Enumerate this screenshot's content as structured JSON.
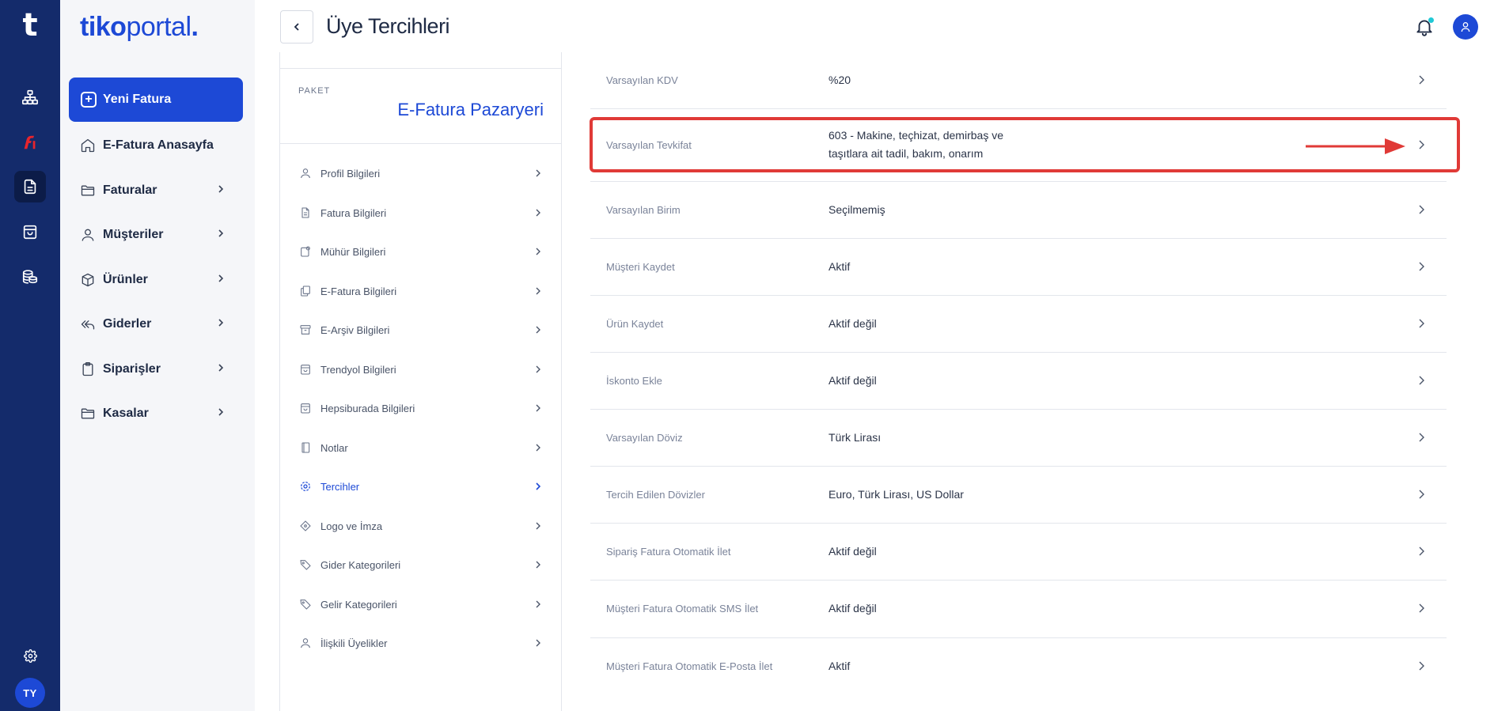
{
  "rail": {
    "logo": "t",
    "items": [
      {
        "icon": "org-chart-icon"
      },
      {
        "icon": "efatura-logo-icon"
      },
      {
        "icon": "document-icon",
        "active": true
      },
      {
        "icon": "shopping-bag-icon"
      },
      {
        "icon": "coins-icon"
      }
    ],
    "settings_icon": "gear-icon",
    "avatar_initials": "TY"
  },
  "brand": {
    "part1": "tiko",
    "part2": "portal",
    "part3": "."
  },
  "nav": {
    "new_invoice_label": "Yeni Fatura",
    "items": [
      {
        "label": "E-Fatura Anasayfa",
        "icon": "home-icon",
        "has_children": false
      },
      {
        "label": "Faturalar",
        "icon": "folder-icon",
        "has_children": true
      },
      {
        "label": "Müşteriler",
        "icon": "user-icon",
        "has_children": true
      },
      {
        "label": "Ürünler",
        "icon": "box-icon",
        "has_children": true
      },
      {
        "label": "Giderler",
        "icon": "reply-all-icon",
        "has_children": true
      },
      {
        "label": "Siparişler",
        "icon": "clipboard-icon",
        "has_children": true
      },
      {
        "label": "Kasalar",
        "icon": "folder-icon",
        "has_children": true
      }
    ]
  },
  "header": {
    "title": "Üye Tercihleri",
    "notification_icon": "bell-icon",
    "user_icon": "user-icon"
  },
  "package": {
    "label": "PAKET",
    "name": "E-Fatura Pazaryeri"
  },
  "menu": {
    "items": [
      {
        "label": "Profil Bilgileri",
        "icon": "user-icon"
      },
      {
        "label": "Fatura Bilgileri",
        "icon": "file-icon"
      },
      {
        "label": "Mühür Bilgileri",
        "icon": "stamp-icon"
      },
      {
        "label": "E-Fatura Bilgileri",
        "icon": "copy-icon"
      },
      {
        "label": "E-Arşiv Bilgileri",
        "icon": "archive-icon"
      },
      {
        "label": "Trendyol Bilgileri",
        "icon": "shopping-bag-icon"
      },
      {
        "label": "Hepsiburada Bilgileri",
        "icon": "shopping-bag-icon"
      },
      {
        "label": "Notlar",
        "icon": "notebook-icon"
      },
      {
        "label": "Tercihler",
        "icon": "gear-icon",
        "active": true
      },
      {
        "label": "Logo ve İmza",
        "icon": "pen-tag-icon"
      },
      {
        "label": "Gider Kategorileri",
        "icon": "tag-icon"
      },
      {
        "label": "Gelir Kategorileri",
        "icon": "tag-icon"
      },
      {
        "label": "İlişkili Üyelikler",
        "icon": "user-icon"
      }
    ]
  },
  "preferences": [
    {
      "label": "Varsayılan KDV",
      "value": "%20"
    },
    {
      "label": "Varsayılan Tevkifat",
      "value_line1": "603 - Makine, teçhizat, demirbaş ve",
      "value_line2": "taşıtlara ait tadil, bakım, onarım",
      "highlighted": true
    },
    {
      "label": "Varsayılan Birim",
      "value": "Seçilmemiş"
    },
    {
      "label": "Müşteri Kaydet",
      "value": "Aktif"
    },
    {
      "label": "Ürün Kaydet",
      "value": "Aktif değil"
    },
    {
      "label": "İskonto Ekle",
      "value": "Aktif değil"
    },
    {
      "label": "Varsayılan Döviz",
      "value": "Türk Lirası"
    },
    {
      "label": "Tercih Edilen Dövizler",
      "value": "Euro, Türk Lirası, US Dollar"
    },
    {
      "label": "Sipariş Fatura Otomatik İlet",
      "value": "Aktif değil"
    },
    {
      "label": "Müşteri Fatura Otomatik SMS İlet",
      "value": "Aktif değil"
    },
    {
      "label": "Müşteri Fatura Otomatik E-Posta İlet",
      "value": "Aktif"
    }
  ],
  "colors": {
    "rail_bg": "#142b6b",
    "accent": "#1d49d6",
    "highlight_border": "#e03a37",
    "notification_dot": "#20c9d6"
  }
}
